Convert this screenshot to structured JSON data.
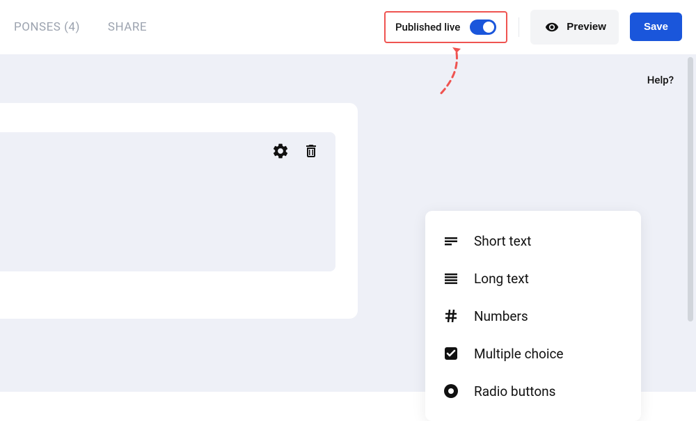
{
  "toolbar": {
    "tabs": {
      "responses": "PONSES (4)",
      "share": "SHARE"
    },
    "publish_label": "Published live",
    "preview_label": "Preview",
    "save_label": "Save"
  },
  "canvas": {
    "help_label": "Help?"
  },
  "field_menu": {
    "items": [
      {
        "label": "Short text",
        "icon": "short-text"
      },
      {
        "label": "Long text",
        "icon": "long-text"
      },
      {
        "label": "Numbers",
        "icon": "hash"
      },
      {
        "label": "Multiple choice",
        "icon": "checkbox"
      },
      {
        "label": "Radio buttons",
        "icon": "radio"
      }
    ]
  }
}
